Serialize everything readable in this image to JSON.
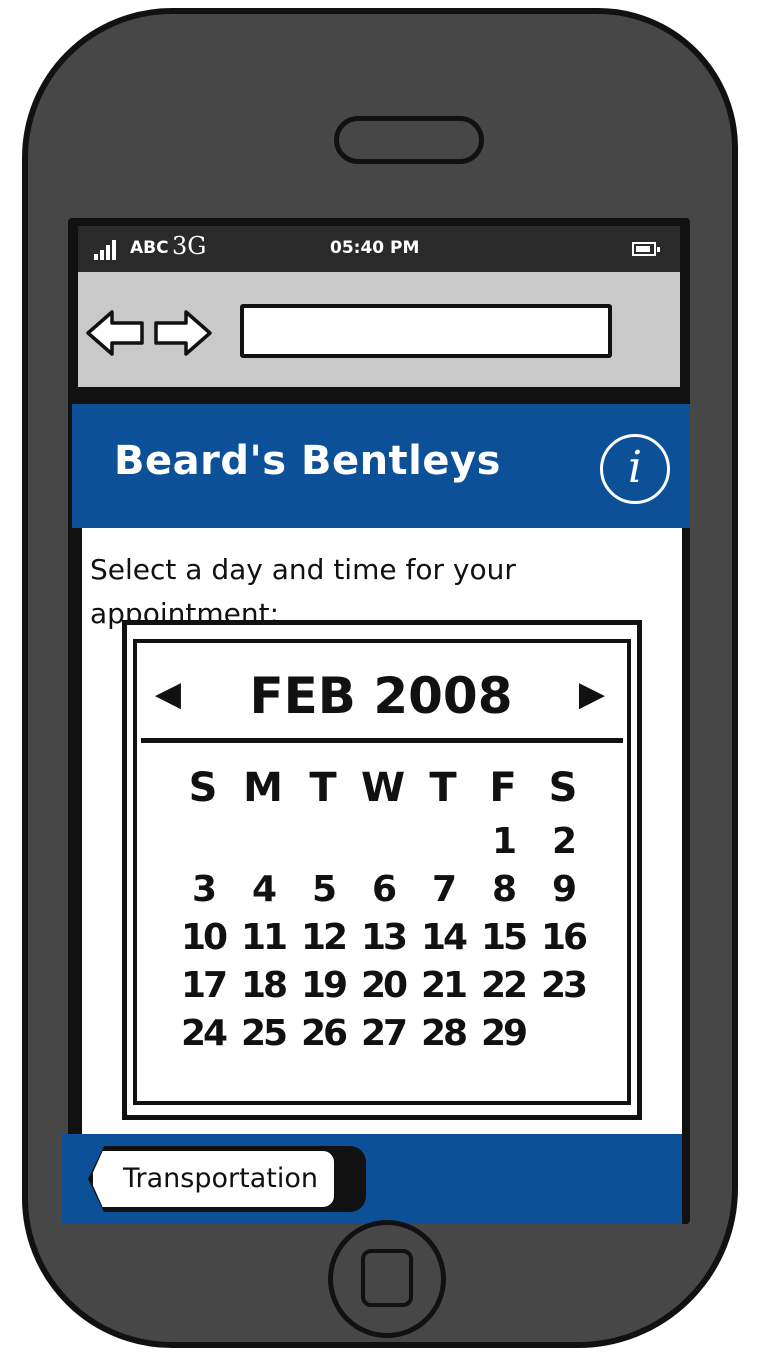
{
  "status_bar": {
    "carrier": "ABC",
    "network": "3G",
    "time": "05:40 PM",
    "signal_icon": "signal-bars-icon",
    "battery_icon": "battery-icon"
  },
  "browser": {
    "back_icon": "left-arrow-icon",
    "forward_icon": "right-arrow-icon",
    "address_value": ""
  },
  "header": {
    "title": "Beard's Bentleys",
    "info_label": "i",
    "info_icon": "info-icon"
  },
  "content": {
    "prompt": "Select a day and time for your appointment:"
  },
  "calendar": {
    "prev_label": "◀",
    "next_label": "▶",
    "month_year": "FEB 2008",
    "weekdays": [
      "S",
      "M",
      "T",
      "W",
      "T",
      "F",
      "S"
    ],
    "weeks": [
      [
        "",
        "",
        "",
        "",
        "",
        "1",
        "2"
      ],
      [
        "3",
        "4",
        "5",
        "6",
        "7",
        "8",
        "9"
      ],
      [
        "10",
        "11",
        "12",
        "13",
        "14",
        "15",
        "16"
      ],
      [
        "17",
        "18",
        "19",
        "20",
        "21",
        "22",
        "23"
      ],
      [
        "24",
        "25",
        "26",
        "27",
        "28",
        "29",
        ""
      ]
    ]
  },
  "bottom_bar": {
    "back_label": "Transportation"
  },
  "colors": {
    "header_blue": "#0c5198",
    "phone_body": "#474747",
    "browser_bar": "#c9c9c9"
  }
}
